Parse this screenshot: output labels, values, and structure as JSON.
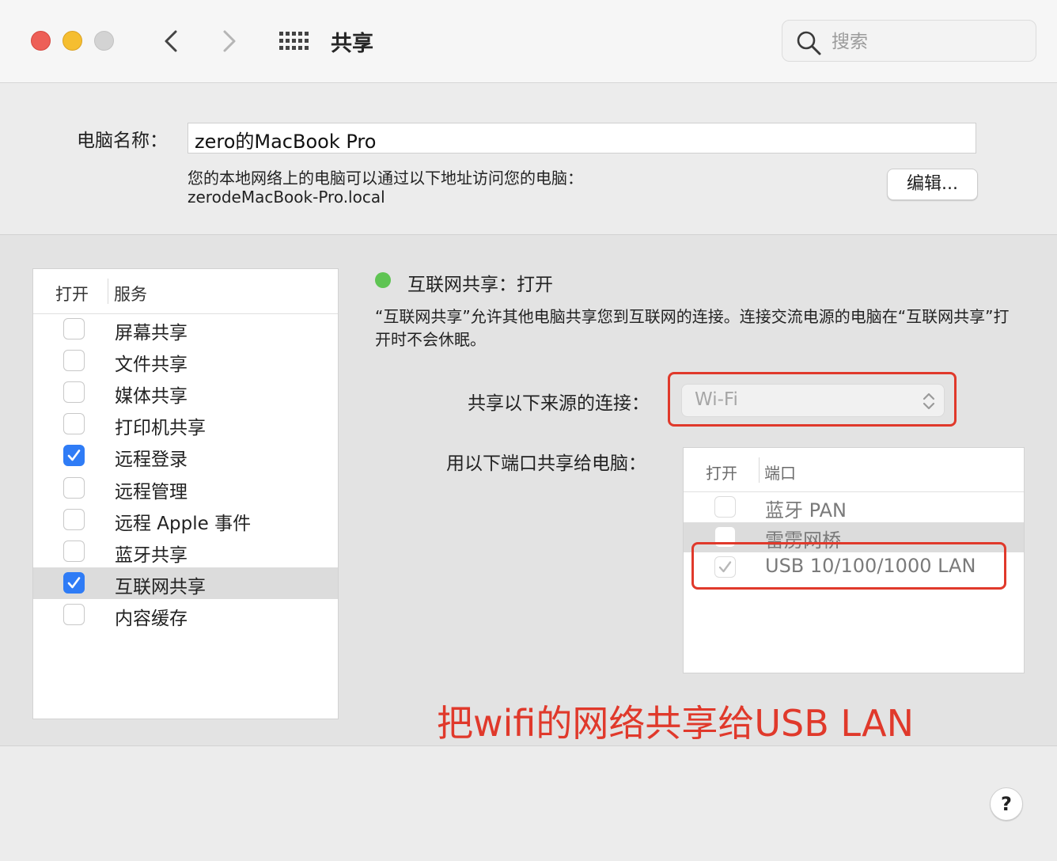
{
  "window": {
    "title": "共享",
    "search_placeholder": "搜索",
    "icons": [
      "back-chevron",
      "forward-chevron",
      "grid-dots",
      "magnifying-glass"
    ]
  },
  "computer_name": {
    "label": "电脑名称：",
    "value": "zero的MacBook Pro",
    "address_desc": "您的本地网络上的电脑可以通过以下地址访问您的电脑：",
    "address": "zerodeMacBook-Pro.local",
    "edit_label": "编辑..."
  },
  "services": {
    "col_open": "打开",
    "col_service": "服务",
    "items": [
      {
        "label": "屏幕共享",
        "checked": false,
        "selected": false
      },
      {
        "label": "文件共享",
        "checked": false,
        "selected": false
      },
      {
        "label": "媒体共享",
        "checked": false,
        "selected": false
      },
      {
        "label": "打印机共享",
        "checked": false,
        "selected": false
      },
      {
        "label": "远程登录",
        "checked": true,
        "selected": false
      },
      {
        "label": "远程管理",
        "checked": false,
        "selected": false
      },
      {
        "label": "远程 Apple 事件",
        "checked": false,
        "selected": false
      },
      {
        "label": "蓝牙共享",
        "checked": false,
        "selected": false
      },
      {
        "label": "互联网共享",
        "checked": true,
        "selected": true
      },
      {
        "label": "内容缓存",
        "checked": false,
        "selected": false
      }
    ]
  },
  "detail": {
    "status": "互联网共享：打开",
    "status_color": "#5fc453",
    "description": "“互联网共享”允许其他电脑共享您到互联网的连接。连接交流电源的电脑在“互联网共享”打开时不会休眠。",
    "source_label": "共享以下来源的连接：",
    "source_value": "Wi-Fi",
    "ports_label": "用以下端口共享给电脑：",
    "ports_col_open": "打开",
    "ports_col_port": "端口",
    "ports": [
      {
        "label": "蓝牙 PAN",
        "checked": false,
        "selected": false
      },
      {
        "label": "雷雳网桥",
        "checked": false,
        "selected": true
      },
      {
        "label": "USB 10/100/1000 LAN",
        "checked": true,
        "selected": false
      }
    ]
  },
  "annotation": {
    "text": "把wifi的网络共享给USB LAN",
    "color": "#e0392b"
  },
  "help_label": "?"
}
